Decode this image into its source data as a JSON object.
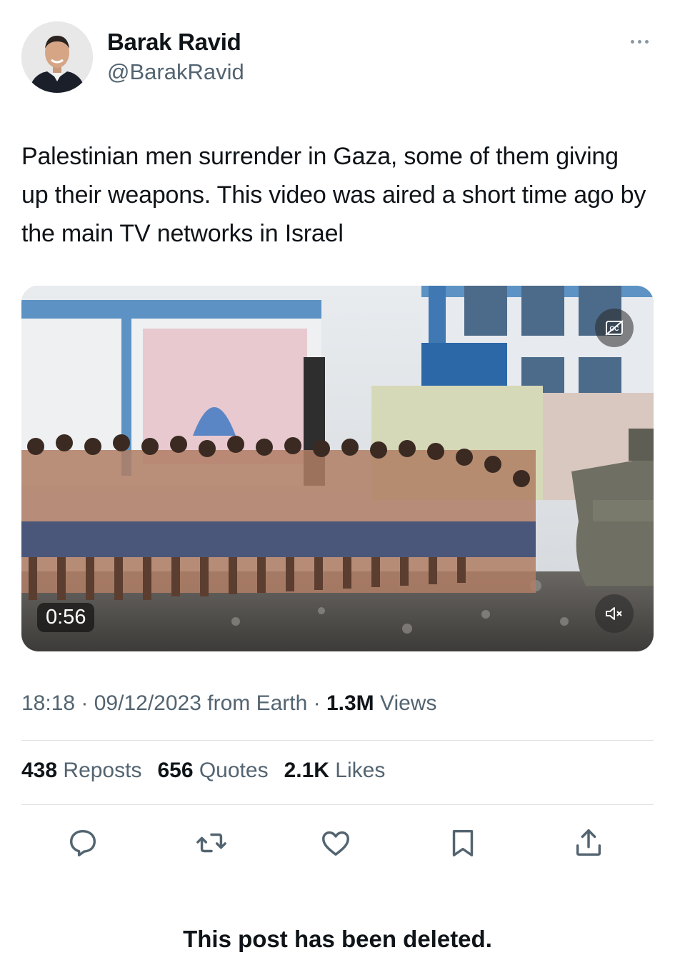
{
  "author": {
    "name": "Barak Ravid",
    "handle": "@BarakRavid"
  },
  "post": {
    "text": "Palestinian men surrender in Gaza, some of them giving up their weapons. This video was aired a short time ago by the main TV networks in Israel",
    "video": {
      "duration": "0:56",
      "captions_icon": "closed-captions-off-icon",
      "mute_icon": "speaker-muted-icon"
    },
    "meta": {
      "time": "18:18",
      "sep1": " · ",
      "date": "09/12/2023",
      "source": " from Earth",
      "sep2": " · ",
      "views_count": "1.3M",
      "views_label": " Views"
    },
    "stats": {
      "reposts_count": "438",
      "reposts_label": " Reposts",
      "quotes_count": "656",
      "quotes_label": " Quotes",
      "likes_count": "2.1K",
      "likes_label": " Likes"
    }
  },
  "actions": [
    "reply-icon",
    "repost-icon",
    "like-icon",
    "bookmark-icon",
    "share-icon"
  ],
  "notice": "This post has been deleted.",
  "colors": {
    "text_primary": "#0f1419",
    "text_secondary": "#536471",
    "divider": "#dfe3e6",
    "icon": "#536471"
  }
}
